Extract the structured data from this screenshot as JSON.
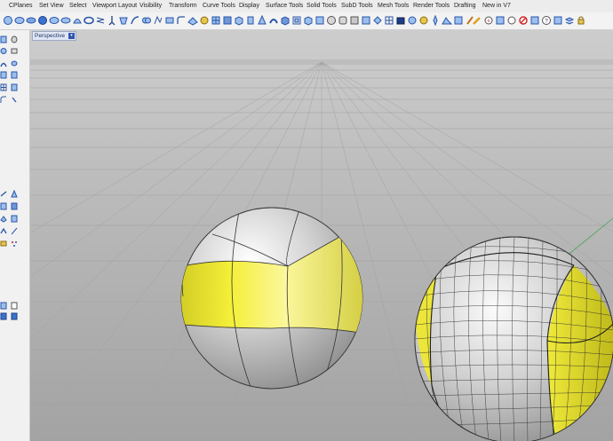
{
  "menu_tabs": [
    "CPlanes",
    "Set View",
    "Select",
    "Viewport Layout",
    "Visibility",
    "Transform",
    "Curve Tools",
    "Display",
    "Surface Tools",
    "Solid Tools",
    "SubD Tools",
    "Mesh Tools",
    "Render Tools",
    "Drafting",
    "New in V7"
  ],
  "viewport": {
    "label": "Perspective",
    "menu_arrow": "▾"
  },
  "colors": {
    "viewport_top": "#c6c6c6",
    "viewport_bottom": "#a4a4a4",
    "grid_line": "#9a9a9a",
    "selection_yellow": "#f2ee35",
    "sphere_grey": "#c4c4c4",
    "toolbar_icon_blue": "#3a6fc8"
  },
  "toolbar_icons": [
    "sphere",
    "ellipsoid",
    "box",
    "cylinder",
    "cone",
    "torus",
    "pipe",
    "pyramid",
    "extrude",
    "loft",
    "sweep",
    "boolean-union",
    "boolean-difference",
    "boolean-intersection",
    "shell",
    "fillet-edge",
    "chamfer",
    "offset",
    "subd-sphere",
    "subd-box",
    "mesh",
    "render",
    "material",
    "light",
    "dimension",
    "text",
    "grid-snap",
    "layers",
    "properties",
    "help",
    "lock"
  ]
}
